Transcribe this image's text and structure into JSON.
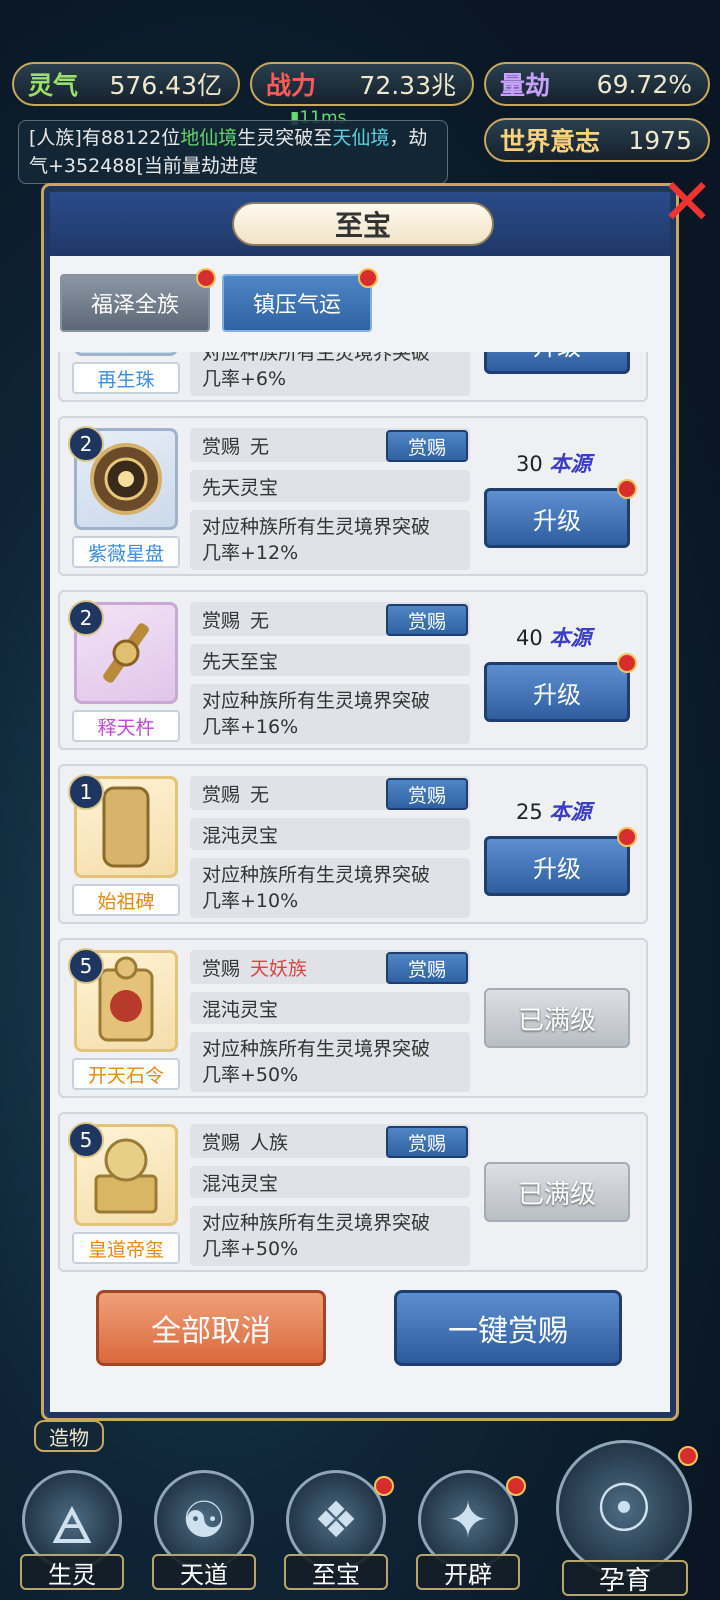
{
  "top_bar": {
    "lingqi": {
      "label": "灵气",
      "value": "576.43亿"
    },
    "zhanli": {
      "label": "战力",
      "value": "72.33兆"
    },
    "liangjie": {
      "label": "量劫",
      "value": "69.72%"
    },
    "shijie": {
      "label": "世界意志",
      "value": "1975"
    },
    "ping": "11ms"
  },
  "news": {
    "prefix": "[人族]有88122位",
    "realm_from": "地仙境",
    "mid": "生灵突破至",
    "realm_to": "天仙境",
    "suffix": "，劫气+352488[当前量劫进度"
  },
  "modal": {
    "title": "至宝",
    "close_icon": "close-x-icon",
    "tabs": [
      {
        "label": "福泽全族"
      },
      {
        "label": "镇压气运"
      }
    ],
    "partial_item": {
      "name": "再生珠",
      "desc_line1": "对应种族所有生灵境界突破",
      "desc_line2": "几率+6%",
      "button": "升级"
    },
    "items": [
      {
        "level": "2",
        "name": "紫薇星盘",
        "reward_label": "赏赐",
        "reward": "无",
        "reward_btn": "赏赐",
        "type": "先天灵宝",
        "desc_line1": "对应种族所有生灵境界突破",
        "desc_line2": "几率+12%",
        "cost": "30",
        "cost_unit": "本源",
        "action": "升级"
      },
      {
        "level": "2",
        "name": "释天杵",
        "reward_label": "赏赐",
        "reward": "无",
        "reward_btn": "赏赐",
        "type": "先天至宝",
        "desc_line1": "对应种族所有生灵境界突破",
        "desc_line2": "几率+16%",
        "cost": "40",
        "cost_unit": "本源",
        "action": "升级"
      },
      {
        "level": "1",
        "name": "始祖碑",
        "reward_label": "赏赐",
        "reward": "无",
        "reward_btn": "赏赐",
        "type": "混沌灵宝",
        "desc_line1": "对应种族所有生灵境界突破",
        "desc_line2": "几率+10%",
        "cost": "25",
        "cost_unit": "本源",
        "action": "升级"
      },
      {
        "level": "5",
        "name": "开天石令",
        "reward_label": "赏赐",
        "reward": "天妖族",
        "reward_btn": "赏赐",
        "type": "混沌灵宝",
        "desc_line1": "对应种族所有生灵境界突破",
        "desc_line2": "几率+50%",
        "action": "已满级"
      },
      {
        "level": "5",
        "name": "皇道帝玺",
        "reward_label": "赏赐",
        "reward": "人族",
        "reward_btn": "赏赐",
        "type": "混沌灵宝",
        "desc_line1": "对应种族所有生灵境界突破",
        "desc_line2": "几率+50%",
        "action": "已满级"
      }
    ],
    "cancel_all": "全部取消",
    "one_click": "一键赏赐",
    "icon_glyphs": {
      "disk": "☸",
      "vajra": "⚒",
      "stele": "碑",
      "token": "令",
      "seal": "玺"
    },
    "stele_text": "始祖碑"
  },
  "bottom_nav": {
    "zaowu": "造物",
    "items": [
      {
        "label": "生灵",
        "icon": "🜁"
      },
      {
        "label": "天道",
        "icon": "☯"
      },
      {
        "label": "至宝",
        "icon": "❖"
      },
      {
        "label": "开辟",
        "icon": "✦"
      },
      {
        "label": "孕育",
        "icon": "☉"
      }
    ]
  }
}
